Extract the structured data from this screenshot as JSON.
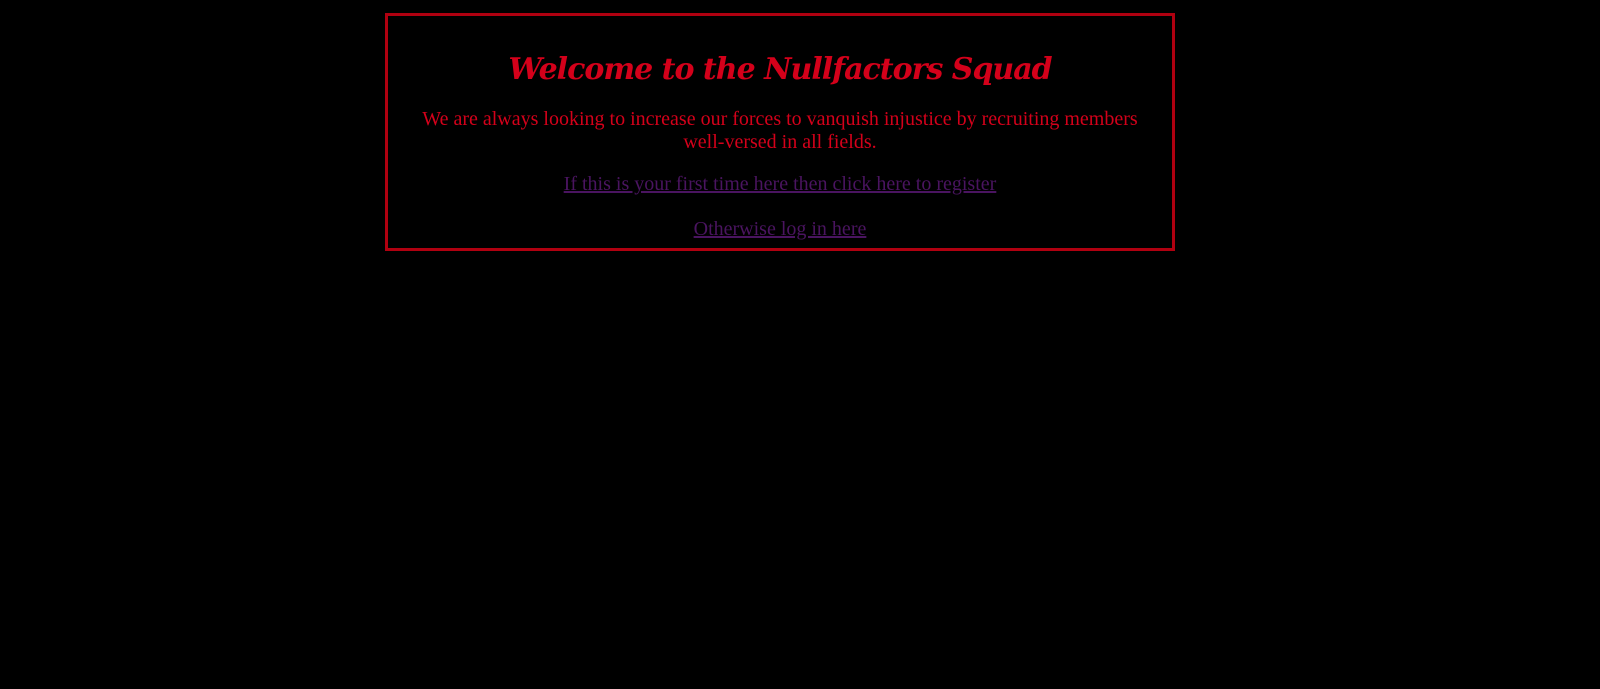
{
  "page": {
    "title": "Welcome to the Nullfactors Squad",
    "intro": "We are always looking to increase our forces to vanquish injustice by recruiting members well-versed in all fields.",
    "register_link": "If this is your first time here then click here to register",
    "login_link": "Otherwise log in here"
  },
  "colors": {
    "background": "#000000",
    "border": "#b00010",
    "text": "#d4001a",
    "link": "#4a1460"
  }
}
